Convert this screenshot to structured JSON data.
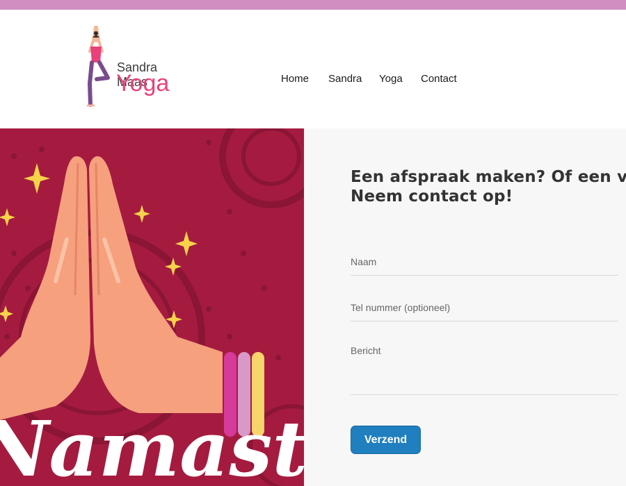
{
  "colors": {
    "topbar": "#d18fc0",
    "brand_pink": "#e8427c",
    "hero_bg": "#a51b3f",
    "hero_pattern": "#8a1535",
    "button": "#1f7fbf"
  },
  "logo": {
    "name": "Sandra Maas",
    "sub": "Yoga"
  },
  "nav": {
    "items": [
      "Home",
      "Sandra",
      "Yoga",
      "Contact"
    ]
  },
  "hero": {
    "text": "Namaste"
  },
  "form": {
    "heading_line1": "Een afspraak maken? Of een vraag?",
    "heading_line2": "Neem contact op!",
    "name_placeholder": "Naam",
    "tel_placeholder": "Tel nummer (optioneel)",
    "message_placeholder": "Bericht",
    "submit_label": "Verzend"
  }
}
